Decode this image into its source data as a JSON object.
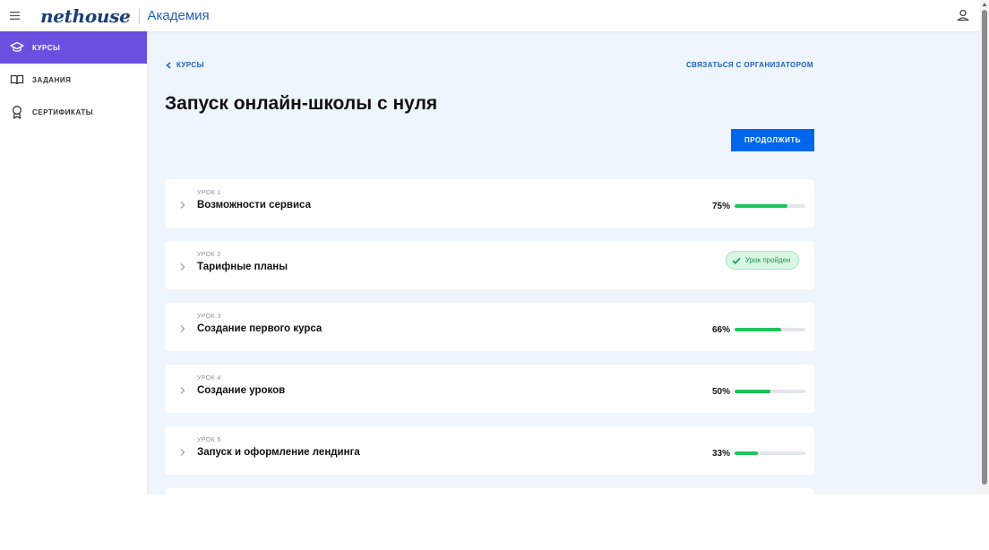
{
  "header": {
    "logo_text": "nethouse",
    "app_name": "Академия",
    "menu_icon": "hamburger-icon",
    "user_icon": "user-icon"
  },
  "sidebar": {
    "items": [
      {
        "label": "КУРСЫ",
        "icon": "graduation-cap-icon",
        "active": true
      },
      {
        "label": "ЗАДАНИЯ",
        "icon": "book-icon",
        "active": false
      },
      {
        "label": "СЕРТИФИКАТЫ",
        "icon": "award-icon",
        "active": false
      }
    ]
  },
  "main": {
    "back_label": "КУРСЫ",
    "contact_label": "СВЯЗАТЬСЯ С ОРГАНИЗАТОРОМ",
    "course_title": "Запуск онлайн-школы с нуля",
    "continue_label": "ПРОДОЛЖИТЬ",
    "lessons": [
      {
        "number": "УРОК 1",
        "title": "Возможности сервиса",
        "progress_text": "75%",
        "progress": 0.75
      },
      {
        "number": "УРОК 2",
        "title": "Тарифные планы",
        "status": "Урок пройден"
      },
      {
        "number": "УРОК 3",
        "title": "Создание первого курса",
        "progress_text": "66%",
        "progress": 0.66
      },
      {
        "number": "УРОК 4",
        "title": "Создание уроков",
        "progress_text": "50%",
        "progress": 0.5
      },
      {
        "number": "УРОК 5",
        "title": "Запуск и оформление лендинга",
        "progress_text": "33%",
        "progress": 0.33
      }
    ]
  },
  "colors": {
    "accent": "#6a4fe0",
    "primary_button": "#0066ee",
    "link": "#1f5fbf",
    "progress": "#1fc45e",
    "background": "#eef5fc"
  }
}
